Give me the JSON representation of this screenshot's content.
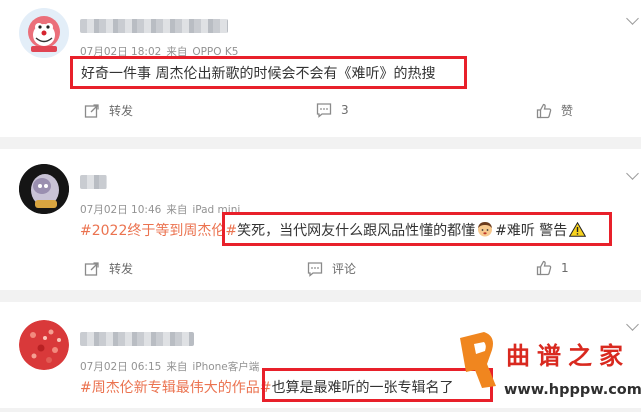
{
  "posts": [
    {
      "time": "07月02日 18:02",
      "source_prefix": "来自",
      "source": "OPPO K5",
      "text": "好奇一件事 周杰伦出新歌的时候会不会有《难听》的热搜",
      "actions": {
        "forward": "转发",
        "comment": "3",
        "like": "赞"
      }
    },
    {
      "time": "07月02日 10:46",
      "source_prefix": "来自",
      "source": "iPad mini",
      "hashtag": "#2022终于等到周杰伦#",
      "text_a": "笑死，当代网友什么跟风品性懂的都懂",
      "text_b": "#难听 警告",
      "actions": {
        "forward": "转发",
        "comment": "评论",
        "like": "1"
      }
    },
    {
      "time": "07月02日 06:15",
      "source_prefix": "来自",
      "source": "iPhone客户端",
      "hashtag": "#周杰伦新专辑最伟大的作品#",
      "text": "也算是最难听的一张专辑名了"
    }
  ],
  "watermark": {
    "brand": "曲谱之家",
    "url": "www.hpppw.com"
  },
  "colors": {
    "accent": "#eb7350",
    "highlight_box": "#e8202a",
    "text": "#333333",
    "meta": "#939393",
    "separator": "#f2f2f2"
  },
  "icons": [
    "forward-icon",
    "comment-icon",
    "like-icon",
    "chevron-down-icon",
    "warning-icon",
    "face-emoji-icon"
  ]
}
